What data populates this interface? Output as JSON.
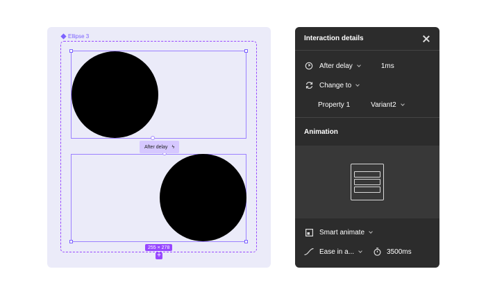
{
  "canvas": {
    "frame_label": "Ellipse 3",
    "delay_tag": "After delay",
    "size_badge": "255 × 278",
    "plus_badge": "+"
  },
  "panel": {
    "title": "Interaction details",
    "trigger": {
      "label": "After delay",
      "value": "1ms"
    },
    "action": {
      "label": "Change to"
    },
    "property": {
      "name": "Property 1",
      "value": "Variant2"
    },
    "animation_section": "Animation",
    "animation": {
      "type": "Smart animate",
      "easing": "Ease in a...",
      "duration": "3500ms"
    }
  },
  "colors": {
    "canvas_bg": "#ebebf9",
    "panel_bg": "#2c2c2c",
    "accent": "#9747ff"
  },
  "icons": [
    "component-icon",
    "timer-icon",
    "swap-icon",
    "close-icon",
    "smart-animate-icon",
    "easing-curve-icon",
    "stopwatch-icon"
  ]
}
